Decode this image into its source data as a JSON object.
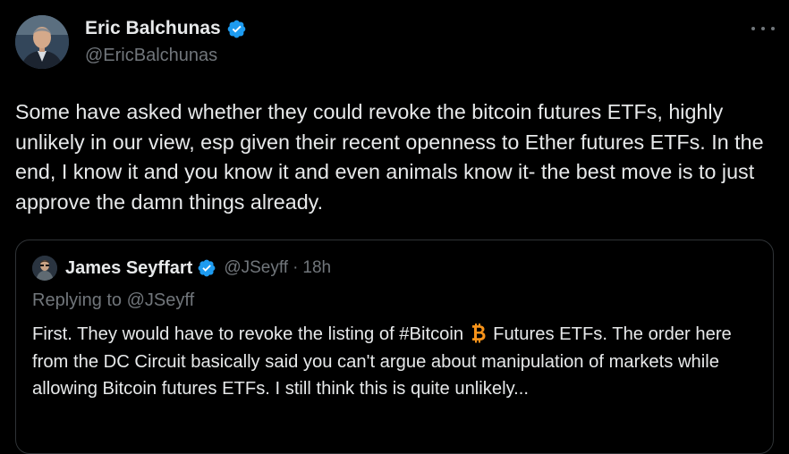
{
  "tweet": {
    "author": {
      "display_name": "Eric Balchunas",
      "handle": "@EricBalchunas",
      "verified_icon": "verified-badge-icon"
    },
    "more_icon": "more-options-icon",
    "text": "Some have asked whether they could revoke the bitcoin futures ETFs, highly unlikely in our view, esp given their recent openness to Ether futures ETFs. In the end, I know it and you know it and even animals know it- the best move is to just approve the damn things already."
  },
  "quoted_tweet": {
    "author": {
      "display_name": "James Seyffart",
      "handle": "@JSeyff",
      "separator": "·",
      "time": "18h"
    },
    "replying_to": "Replying to @JSeyff",
    "text_before_emoji": "First. They would have to revoke the listing of #Bitcoin",
    "emoji_icon": "bitcoin-icon",
    "text_after_emoji": "Futures ETFs. The order here from the DC Circuit basically said you can't argue about manipulation of markets while allowing Bitcoin futures ETFs. I still think this is quite unlikely..."
  },
  "colors": {
    "background": "#000000",
    "primary_text": "#e7e9ea",
    "secondary_text": "#71767b",
    "border": "#2f3336",
    "verified_blue": "#1d9bf0",
    "bitcoin_orange": "#f7931a"
  }
}
